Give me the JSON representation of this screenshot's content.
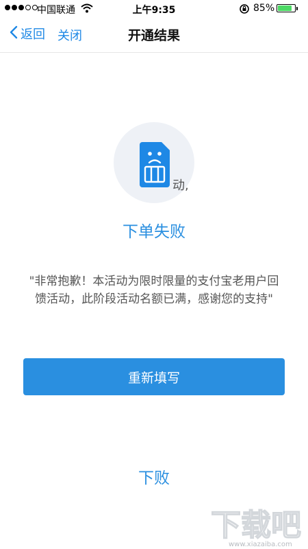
{
  "status_bar": {
    "carrier": "中国联通",
    "time": "上午9:35",
    "battery_percent": "85%",
    "battery_level": 0.85,
    "icons": [
      "signal-dots-icon",
      "wifi-icon",
      "rotation-lock-icon",
      "battery-icon"
    ]
  },
  "nav": {
    "back_label": "返回",
    "close_label": "关闭",
    "title": "开通结果"
  },
  "result": {
    "icon": "sad-sim-card-icon",
    "stray_text": "动,",
    "title": "下单失败",
    "message": "\"非常抱歉！本活动为限时限量的支付宝老用户回馈活动，此阶段活动名额已满，感谢您的支持\""
  },
  "actions": {
    "refill_label": "重新填写"
  },
  "bottom_status": "下败",
  "watermark": {
    "text": "下载吧",
    "url_text": "www.xiazaiba.com"
  },
  "colors": {
    "accent": "#1e88e5",
    "button": "#2a8fe0",
    "battery_fill": "#4cd964",
    "icon_bg": "#eef1f6"
  }
}
